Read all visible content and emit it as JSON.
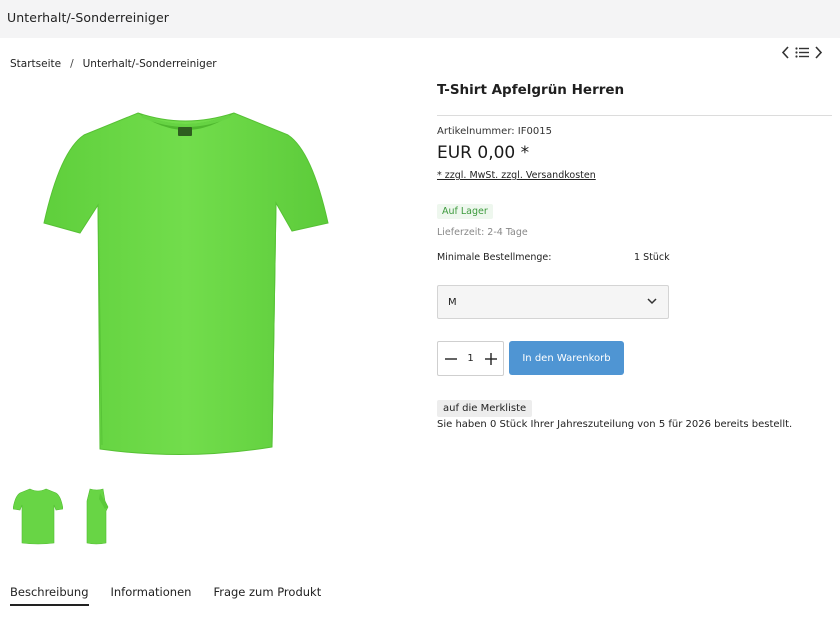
{
  "header": {
    "title": "Unterhalt/-Sonderreiniger"
  },
  "breadcrumb": {
    "items": [
      "Startseite",
      "Unterhalt/-Sonderreiniger"
    ],
    "separator": "/"
  },
  "nav_icons": [
    "chevron-left-icon",
    "list-icon",
    "chevron-right-icon"
  ],
  "gallery": {
    "main_image_color": "#6fdb4a",
    "thumbnails": [
      "front",
      "side"
    ]
  },
  "product": {
    "title": "T-Shirt Apfelgrün Herren",
    "sku": "Artikelnummer: IF0015",
    "price": "EUR 0,00 *",
    "tax_note": "* zzgl. MwSt. zzgl. Versandkosten",
    "stock": "Auf Lager",
    "delivery": "Lieferzeit: 2-4 Tage",
    "min_order_label": "Minimale Bestellmenge:",
    "min_order_value": "1 Stück",
    "variant_selected": "M",
    "quantity": "1",
    "add_to_cart": "In den Warenkorb",
    "wishlist": "auf die Merkliste",
    "allocation_note": "Sie haben 0 Stück Ihrer Jahreszuteilung von 5 für 2026 bereits bestellt."
  },
  "tabs": [
    {
      "label": "Beschreibung",
      "active": true
    },
    {
      "label": "Informationen",
      "active": false
    },
    {
      "label": "Frage zum Produkt",
      "active": false
    }
  ],
  "colors": {
    "accent": "#4f95d3",
    "stock_green": "#3c9a3c",
    "shirt_green": "#6fdb4a"
  }
}
